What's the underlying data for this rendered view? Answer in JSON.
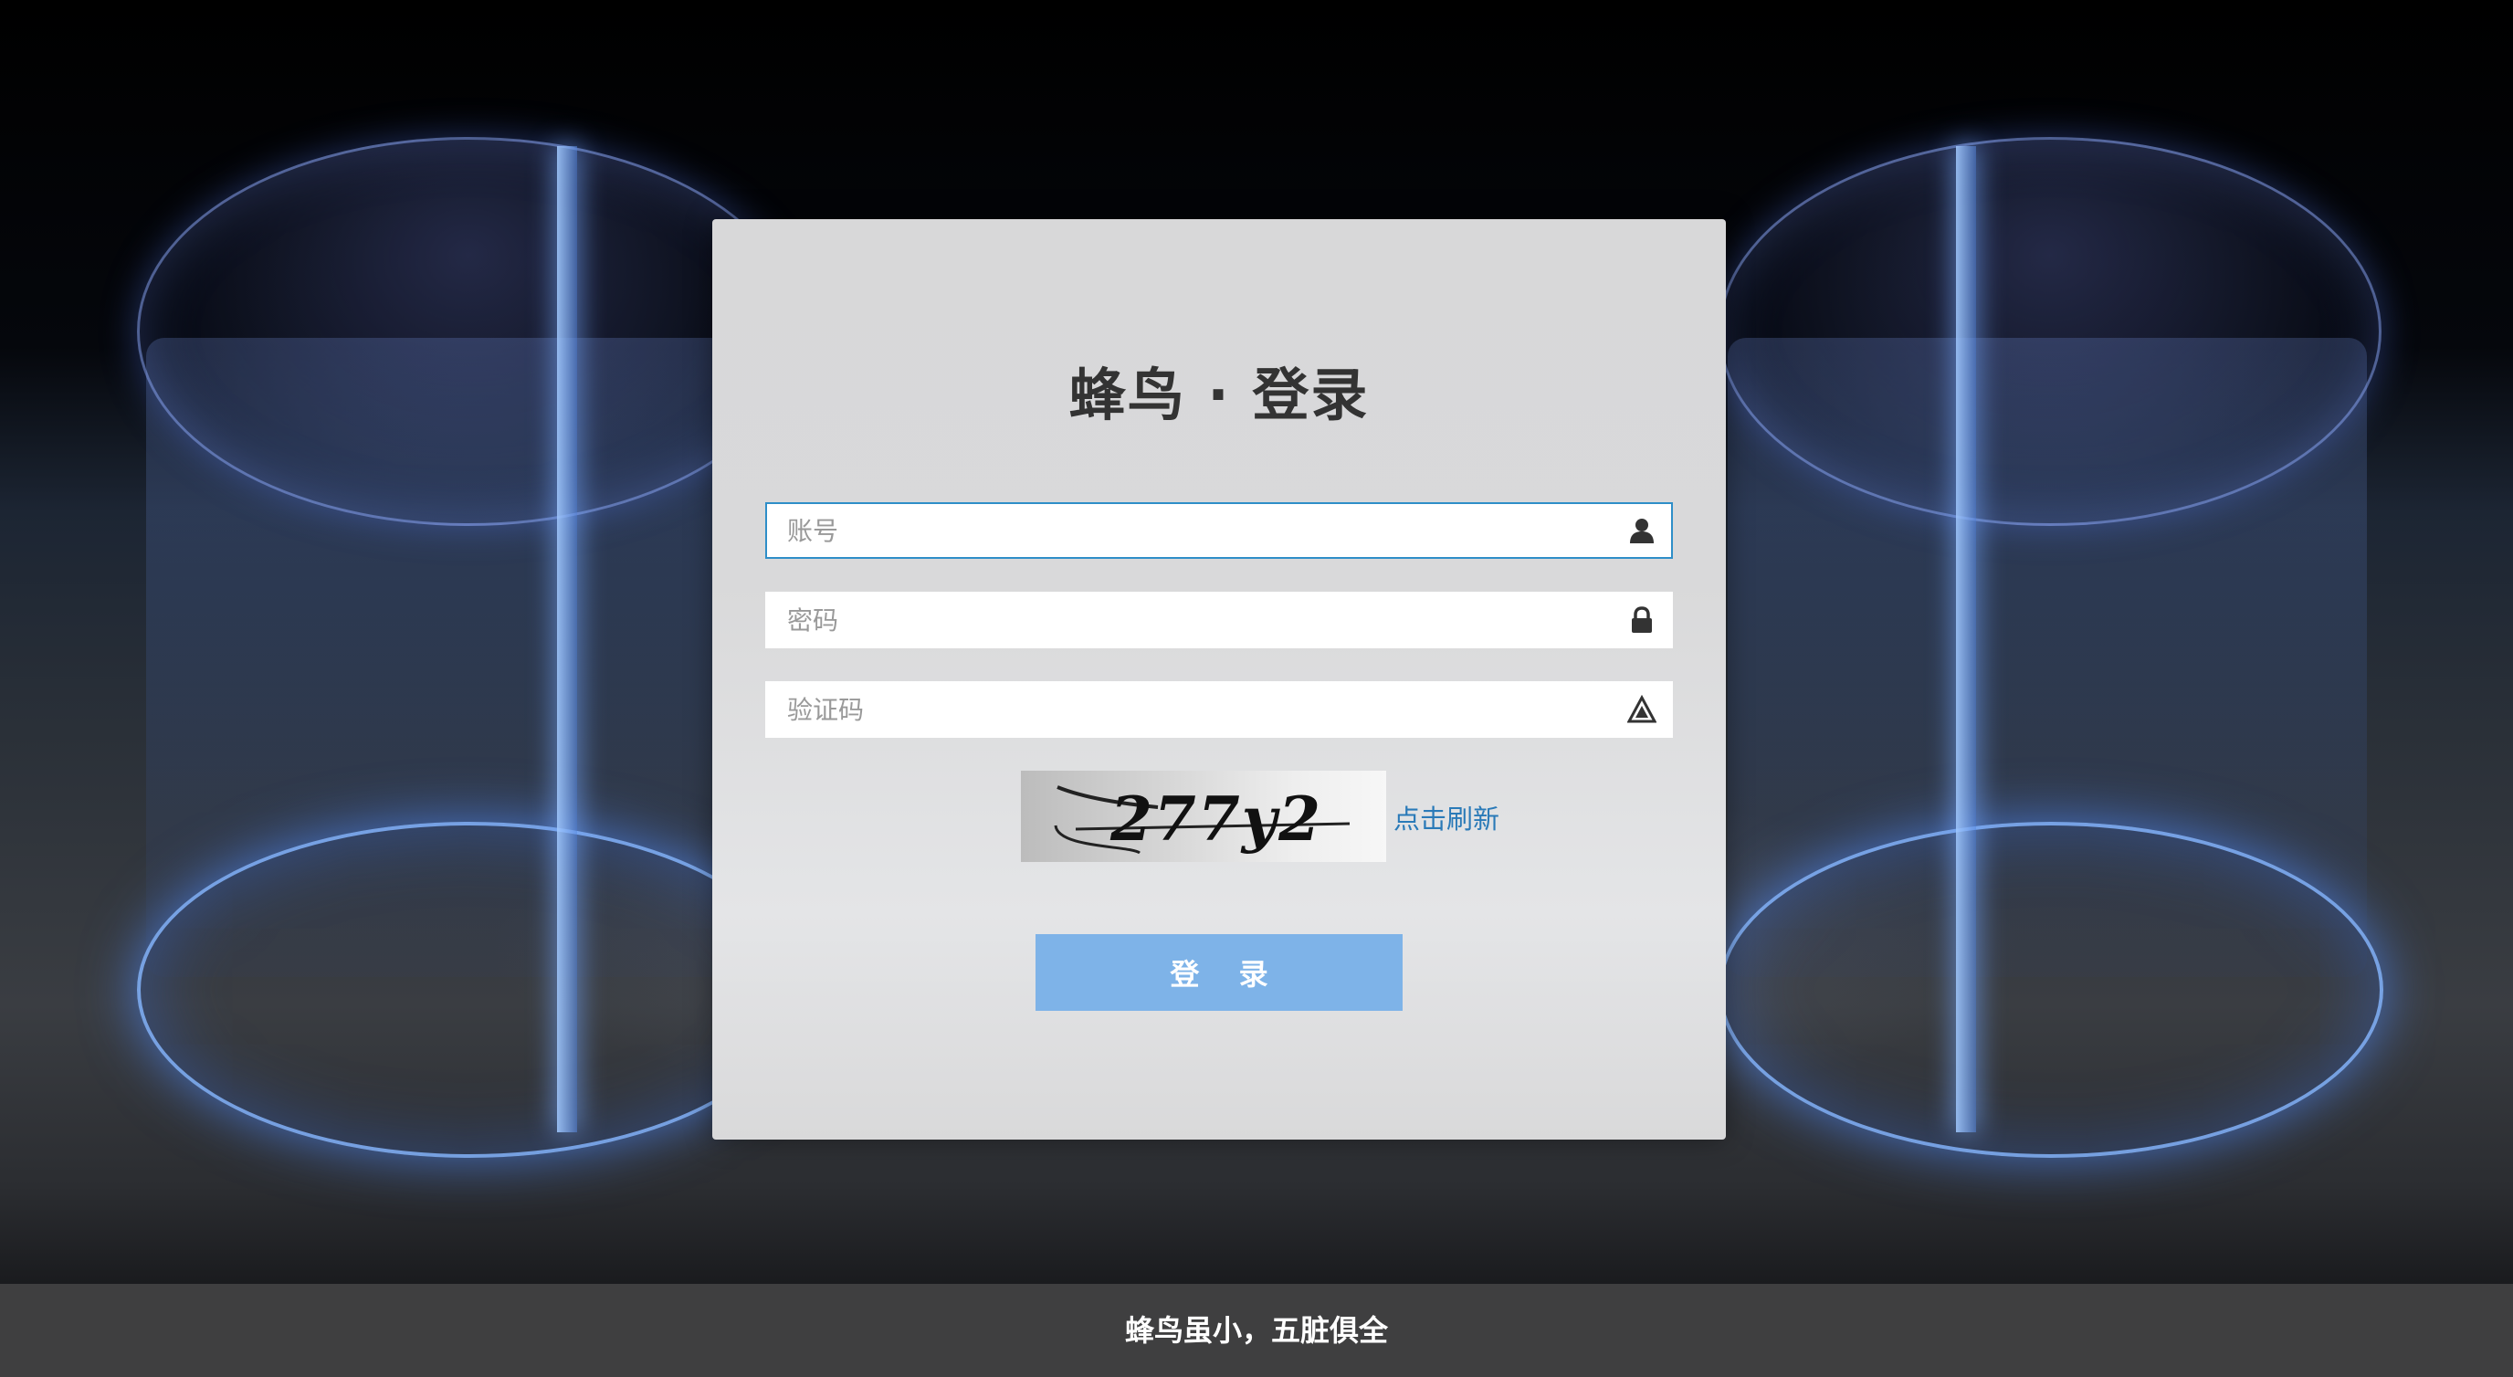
{
  "login": {
    "title": "蜂鸟 · 登录",
    "account_placeholder": "账号",
    "password_placeholder": "密码",
    "captcha_placeholder": "验证码",
    "captcha_text": "277y2",
    "refresh_label": "点击刷新",
    "submit_label": "登 录"
  },
  "icons": {
    "account": "user-icon",
    "password": "lock-icon",
    "captcha": "warning-icon"
  },
  "colors": {
    "button": "#7eb3e8",
    "link": "#2a7ab8",
    "focus_border": "#2e8ec8",
    "footer_bg": "#3f3f40"
  },
  "footer": {
    "slogan": "蜂鸟虽小，五脏俱全"
  }
}
